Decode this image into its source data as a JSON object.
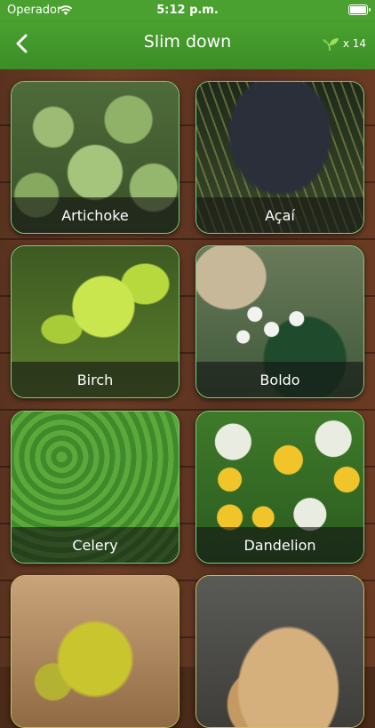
{
  "status": {
    "carrier": "Operador",
    "time": "5:12 p.m."
  },
  "navbar": {
    "title": "Slim down",
    "credits": "x 14"
  },
  "tiles": [
    {
      "label": "Artichoke"
    },
    {
      "label": "Açaí"
    },
    {
      "label": "Birch"
    },
    {
      "label": "Boldo"
    },
    {
      "label": "Celery"
    },
    {
      "label": "Dandelion"
    },
    {
      "label": ""
    },
    {
      "label": ""
    }
  ],
  "colors": {
    "bar_green": "#4aa12f",
    "tile_border": "#7ad17a",
    "wood": "#5a3320"
  }
}
